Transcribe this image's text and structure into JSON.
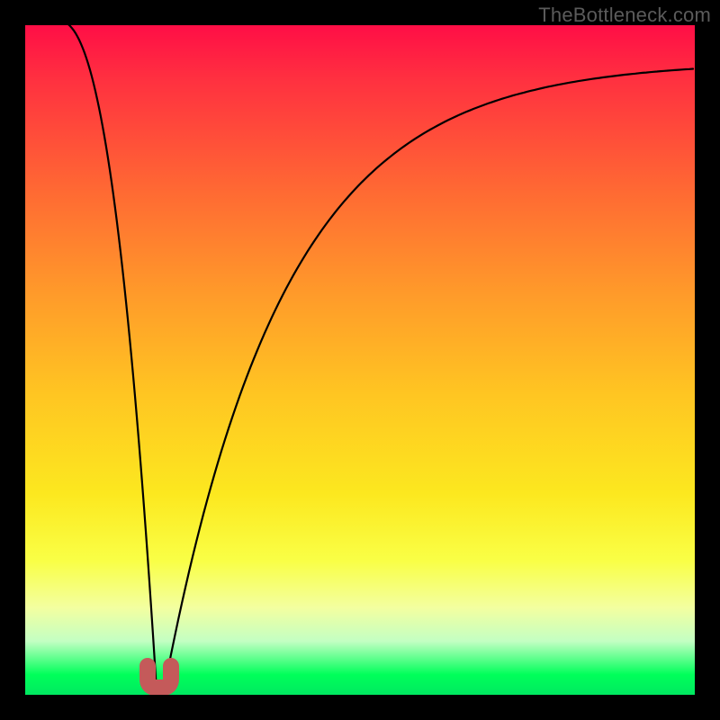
{
  "watermark": "TheBottleneck.com",
  "chart_data": {
    "type": "line",
    "title": "",
    "xlabel": "",
    "ylabel": "",
    "xlim": [
      0,
      100
    ],
    "ylim": [
      0,
      100
    ],
    "grid": false,
    "legend": false,
    "series": [
      {
        "name": "bottleneck-curve",
        "x": [
          5,
          10,
          15,
          18,
          20,
          22,
          25,
          30,
          35,
          40,
          50,
          60,
          70,
          80,
          90,
          100
        ],
        "values": [
          100,
          60,
          22,
          5,
          0,
          3,
          12,
          28,
          40,
          50,
          64,
          74,
          81,
          86,
          89,
          91
        ]
      }
    ],
    "marker": {
      "name": "optimal-u-marker",
      "x": 20,
      "y": 1,
      "color": "#c45a5a"
    },
    "background_gradient": {
      "top": "#ff0e46",
      "bottom": "#00e860",
      "meaning": "red=high bottleneck, green=low bottleneck"
    }
  }
}
